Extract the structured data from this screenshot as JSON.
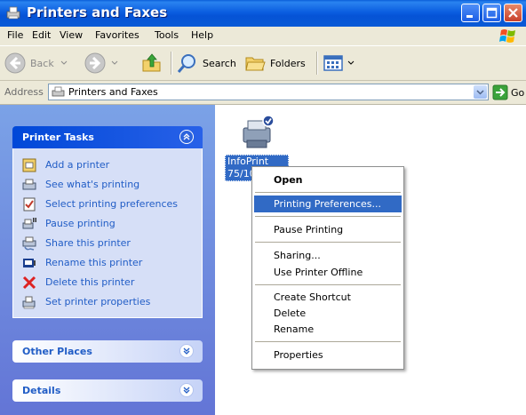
{
  "window": {
    "title": "Printers and Faxes"
  },
  "menubar": {
    "items": [
      "File",
      "Edit",
      "View",
      "Favorites",
      "Tools",
      "Help"
    ]
  },
  "toolbar": {
    "back_label": "Back",
    "search_label": "Search",
    "folders_label": "Folders"
  },
  "address": {
    "label": "Address",
    "value": "Printers and Faxes",
    "go_label": "Go"
  },
  "tasks": {
    "printer_tasks": {
      "title": "Printer Tasks",
      "items": [
        {
          "label": "Add a printer",
          "icon": "add-printer-icon"
        },
        {
          "label": "See what's printing",
          "icon": "printer-queue-icon"
        },
        {
          "label": "Select printing preferences",
          "icon": "preferences-icon"
        },
        {
          "label": "Pause printing",
          "icon": "pause-printer-icon"
        },
        {
          "label": "Share this printer",
          "icon": "share-printer-icon"
        },
        {
          "label": "Rename this printer",
          "icon": "rename-icon"
        },
        {
          "label": "Delete this printer",
          "icon": "delete-icon"
        },
        {
          "label": "Set printer properties",
          "icon": "properties-icon"
        }
      ]
    },
    "other_places": {
      "title": "Other Places"
    },
    "details": {
      "title": "Details"
    }
  },
  "content": {
    "printer_label_line1": "InfoPrint",
    "printer_label_line2": "75/10"
  },
  "context_menu": {
    "items": [
      "Open",
      "Printing Preferences...",
      "Pause Printing",
      "Sharing...",
      "Use Printer Offline",
      "Create Shortcut",
      "Delete",
      "Rename",
      "Properties"
    ],
    "selected": "Printing Preferences..."
  },
  "colors": {
    "titlebar": "#0b5ee0",
    "selection": "#316ac5",
    "task_link": "#215dc6",
    "pane": "#7ba2e7"
  }
}
